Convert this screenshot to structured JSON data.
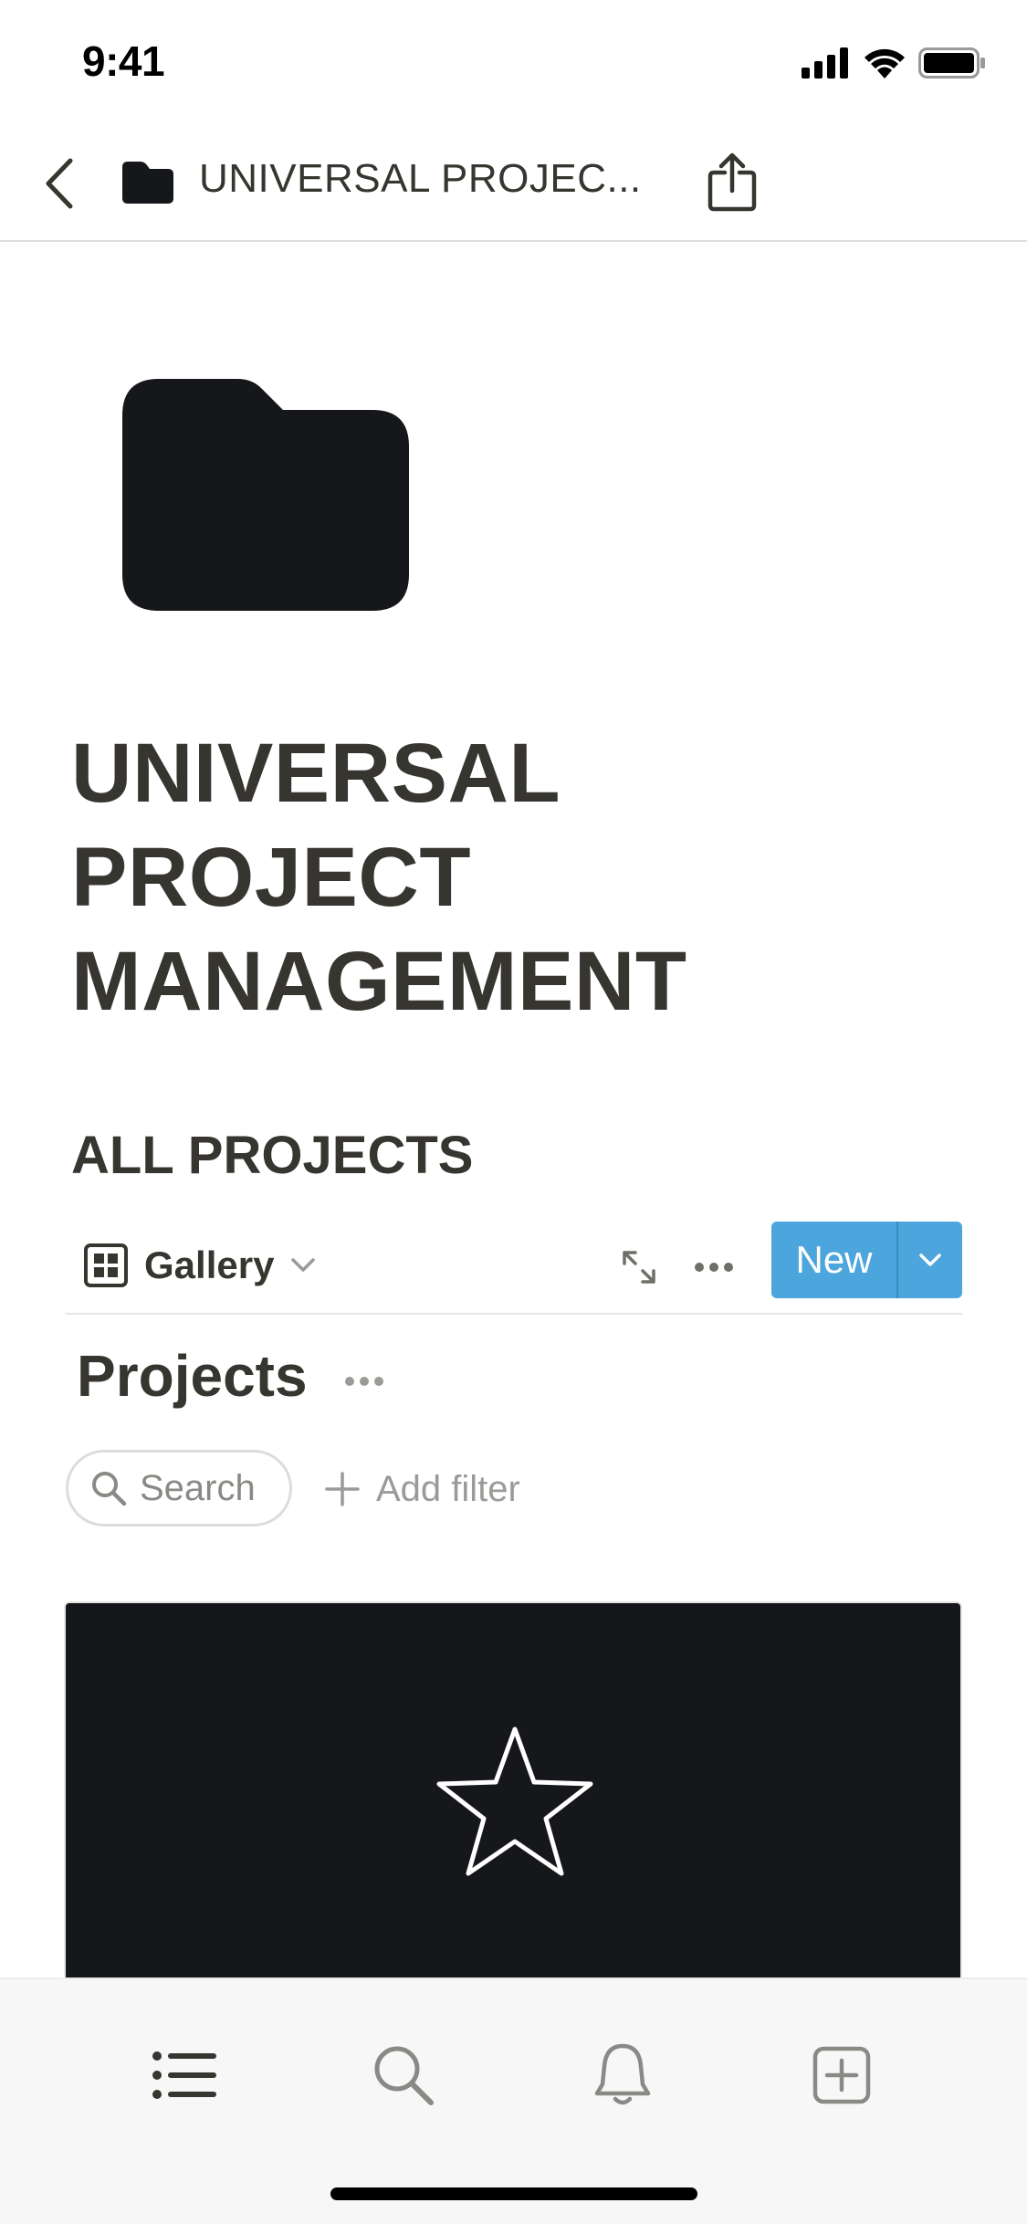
{
  "status_bar": {
    "time": "9:41",
    "icons": [
      "cellular-signal-icon",
      "wifi-icon",
      "battery-icon"
    ]
  },
  "nav": {
    "back_icon": "chevron-left-icon",
    "folder_icon": "folder-icon",
    "title": "UNIVERSAL PROJEC...",
    "share_icon": "share-icon"
  },
  "page": {
    "icon": "folder-icon",
    "title_lines": [
      "UNIVERSAL",
      "PROJECT",
      "MANAGEMENT"
    ],
    "section_heading": "ALL PROJECTS"
  },
  "view_toolbar": {
    "view_icon": "gallery-grid-icon",
    "view_name": "Gallery",
    "view_chevron_icon": "chevron-down-icon",
    "expand_icon": "expand-icon",
    "more_icon": "ellipsis-icon",
    "new_label": "New",
    "new_menu_icon": "chevron-down-icon"
  },
  "database": {
    "title": "Projects",
    "more_icon": "ellipsis-icon",
    "search_label": "Search",
    "add_filter_label": "Add filter"
  },
  "gallery": {
    "cards": [
      {
        "cover_icon": "star-icon"
      }
    ]
  },
  "tab_bar": {
    "items": [
      {
        "icon": "list-icon"
      },
      {
        "icon": "search-icon"
      },
      {
        "icon": "bell-icon"
      },
      {
        "icon": "new-page-icon"
      }
    ]
  },
  "colors": {
    "text": "#37352f",
    "accent": "#4ca5dc",
    "card_background": "#16171b",
    "muted": "#9b9a97"
  }
}
